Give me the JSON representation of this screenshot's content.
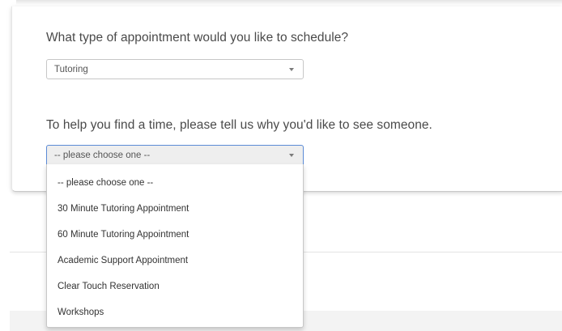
{
  "form": {
    "appointment_type_question": "What type of appointment would you like to schedule?",
    "appointment_type_value": "Tutoring",
    "reason_question": "To help you find a time, please tell us why you'd like to see someone.",
    "reason_value": "-- please choose one --"
  },
  "reason_dropdown": {
    "options": [
      "-- please choose one --",
      "30 Minute Tutoring Appointment",
      "60 Minute Tutoring Appointment",
      "Academic Support Appointment",
      "Clear Touch Reservation",
      "Workshops"
    ]
  },
  "colors": {
    "text": "#4a4a4a",
    "focus_border": "#5b8bd6",
    "active_select_bg": "#eeeeee"
  },
  "icons": {
    "select_caret": "chevron-down-icon"
  }
}
